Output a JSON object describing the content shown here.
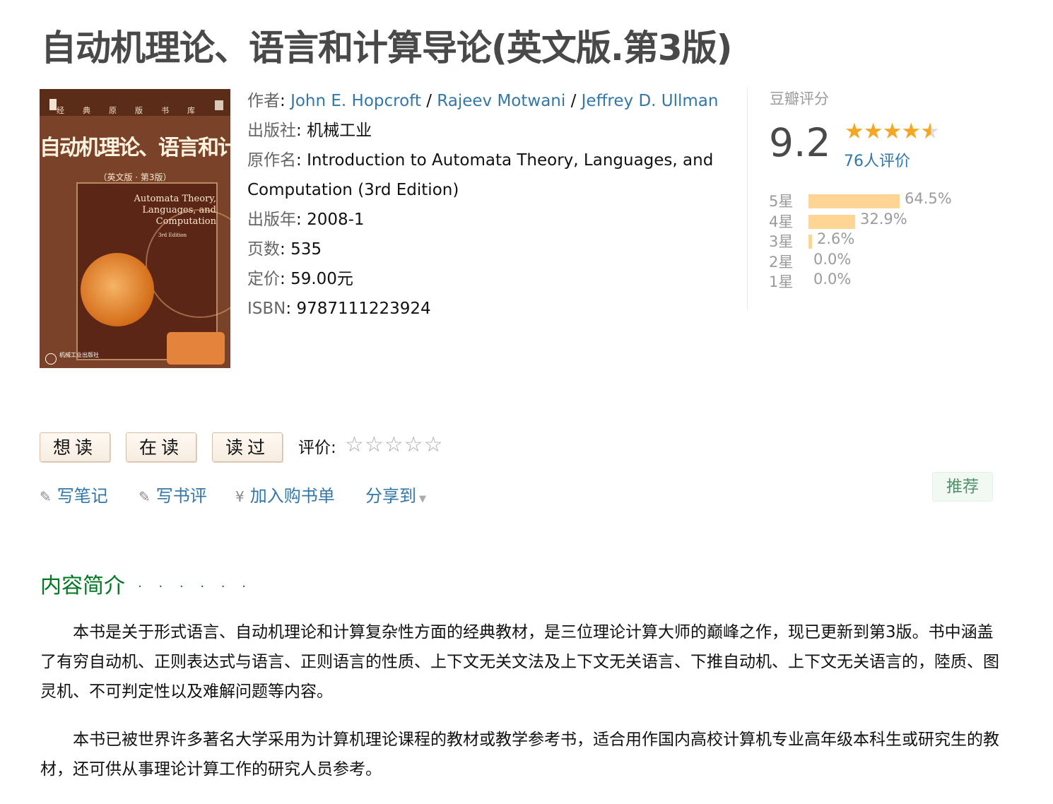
{
  "book": {
    "title": "自动机理论、语言和计算导论(英文版.第3版)"
  },
  "cover": {
    "series": "经典原版书库",
    "title": "自动机理论、语言和计算导论",
    "edition": "（英文版 · 第3版）",
    "en_title_line1": "Automata Theory,",
    "en_title_line2": "Languages, and",
    "en_title_line3": "Computation",
    "en_edition": "3rd Edition",
    "publisher": "机械工业出版社"
  },
  "info": {
    "author_label": "作者",
    "authors": [
      "John E. Hopcroft",
      "Rajeev Motwani",
      "Jeffrey D. Ullman"
    ],
    "author_sep": " / ",
    "publisher_label": "出版社",
    "publisher": "机械工业",
    "original_title_label": "原作名",
    "original_title": "Introduction to Automata Theory, Languages, and Computation (3rd Edition)",
    "pubdate_label": "出版年",
    "pubdate": "2008-1",
    "pages_label": "页数",
    "pages": "535",
    "price_label": "定价",
    "price": "59.00元",
    "isbn_label": "ISBN",
    "isbn": "9787111223924",
    "colon": ": "
  },
  "rating": {
    "label": "豆瓣评分",
    "score": "9.2",
    "stars_value": 4.5,
    "count_text": "76人评价",
    "distribution": [
      {
        "label": "5星",
        "percent": 64.5,
        "text": "64.5%"
      },
      {
        "label": "4星",
        "percent": 32.9,
        "text": "32.9%"
      },
      {
        "label": "3星",
        "percent": 2.6,
        "text": "2.6%"
      },
      {
        "label": "2星",
        "percent": 0.0,
        "text": "0.0%"
      },
      {
        "label": "1星",
        "percent": 0.0,
        "text": "0.0%"
      }
    ],
    "bar_color": "#ffd596"
  },
  "actions": {
    "want_read": "想读",
    "reading": "在读",
    "read": "读过",
    "rate_label": "评价:",
    "empty_stars": "☆☆☆☆☆",
    "write_note": "写笔记",
    "write_review": "写书评",
    "add_cart": "加入购书单",
    "share": "分享到",
    "recommend": "推荐",
    "pencil_icon": "pencil-icon",
    "yen_icon": "¥"
  },
  "summary": {
    "heading": "内容简介",
    "dots": "· · · · · ·",
    "paragraphs": [
      "本书是关于形式语言、自动机理论和计算复杂性方面的经典教材，是三位理论计算大师的巅峰之作，现已更新到第3版。书中涵盖了有穷自动机、正则表达式与语言、正则语言的性质、上下文无关文法及上下文无关语言、下推自动机、上下文无关语言的，陸质、图灵机、不可判定性以及难解问题等内容。",
      "本书已被世界许多著名大学采用为计算机理论课程的教材或教学参考书，适合用作国内高校计算机专业高年级本科生或研究生的教材，还可供从事理论计算工作的研究人员参考。"
    ]
  },
  "colors": {
    "link": "#3377aa",
    "star": "#f5a623",
    "green_heading": "#007722",
    "title": "#494949"
  }
}
